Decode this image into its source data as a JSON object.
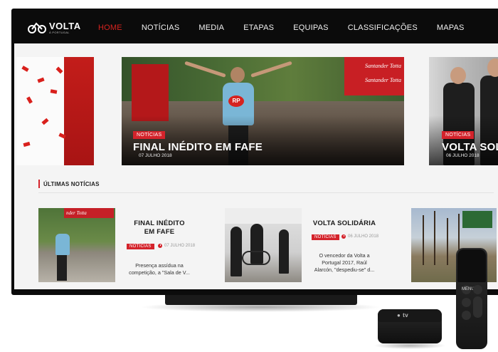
{
  "site": {
    "logo_main": "VOLTA",
    "logo_sub": "À PORTUGAL"
  },
  "nav": {
    "items": [
      {
        "label": "HOME",
        "active": true
      },
      {
        "label": "NOTÍCIAS",
        "active": false
      },
      {
        "label": "MEDIA",
        "active": false
      },
      {
        "label": "ETAPAS",
        "active": false
      },
      {
        "label": "EQUIPAS",
        "active": false
      },
      {
        "label": "CLASSIFICAÇÕES",
        "active": false
      },
      {
        "label": "MAPAS",
        "active": false
      }
    ]
  },
  "hero": {
    "main": {
      "tag": "NOTÍCIAS",
      "title": "FINAL INÉDITO EM FAFE",
      "date": "07 JULHO 2018",
      "sponsor": "Santander Totta",
      "rider_badge": "RP"
    },
    "right": {
      "tag": "NOTÍCIAS",
      "title": "VOLTA SOLID",
      "date": "06 JULHO 2018"
    }
  },
  "latest": {
    "title": "ÚLTIMAS NOTÍCIAS",
    "cards": [
      {
        "title_line1": "FINAL INÉDITO",
        "title_line2": "EM FAFE",
        "tag": "NOTÍCIAS",
        "date": "07 JULHO 2018",
        "desc_line1": "Presença assídua na",
        "desc_line2": "competição, a \"Sala de V...",
        "thumb_banner": "nder Totta"
      },
      {
        "title_line1": "VOLTA SOLIDÁRIA",
        "tag": "NOTÍCIAS",
        "date": "06 JULHO 2018",
        "desc_line1": "O vencedor da Volta a",
        "desc_line2": "Portugal 2017, Raúl",
        "desc_line3": "Alarcón, \"despediu-se\" d..."
      }
    ]
  },
  "device": {
    "box_label": "tv",
    "remote_menu": "MENU"
  },
  "colors": {
    "accent": "#d4232b",
    "nav_bg": "#0b0b0b"
  }
}
